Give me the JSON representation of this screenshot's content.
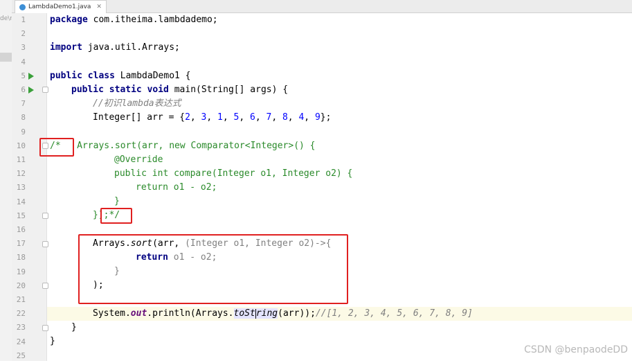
{
  "editor": {
    "tab_title": "LambdaDemo1.java",
    "left_panel_fragment": "de\\n",
    "watermark": "CSDN @benpaodeDD"
  },
  "lines": [
    {
      "n": "1"
    },
    {
      "n": "2"
    },
    {
      "n": "3"
    },
    {
      "n": "4"
    },
    {
      "n": "5"
    },
    {
      "n": "6"
    },
    {
      "n": "7"
    },
    {
      "n": "8"
    },
    {
      "n": "9"
    },
    {
      "n": "10"
    },
    {
      "n": "11"
    },
    {
      "n": "12"
    },
    {
      "n": "13"
    },
    {
      "n": "14"
    },
    {
      "n": "15"
    },
    {
      "n": "16"
    },
    {
      "n": "17"
    },
    {
      "n": "18"
    },
    {
      "n": "19"
    },
    {
      "n": "20"
    },
    {
      "n": "21"
    },
    {
      "n": "22"
    },
    {
      "n": "23"
    },
    {
      "n": "24"
    },
    {
      "n": "25"
    }
  ],
  "code": {
    "l1_kw": "package",
    "l1_rest": " com.itheima.lambdademo;",
    "l3_kw": "import",
    "l3_rest": " java.util.Arrays;",
    "l5_kw": "public class",
    "l5_rest": " LambdaDemo1 {",
    "l6_kw": "public static void",
    "l6_rest": " main(String[] args) {",
    "l7_cm": "//初识lambda表达式",
    "l8_a": "Integer[] arr = {",
    "l8_nums": [
      "2",
      "3",
      "1",
      "5",
      "6",
      "7",
      "8",
      "4",
      "9"
    ],
    "l8_end": "};",
    "l10_open": "/*",
    "l10_rest": "   Arrays.sort(arr, new Comparator<Integer>() {",
    "l11": "@Override",
    "l12": "public int compare(Integer o1, Integer o2) {",
    "l13": "return o1 - o2;",
    "l14": "}",
    "l15_a": "});",
    "l15_b": "*/",
    "l17_a": "Arrays.",
    "l17_m": "sort",
    "l17_b": "(arr, ",
    "l17_hint": "(Integer o1, Integer o2)->{",
    "l18_kw": "return",
    "l18_rest": " o1 - o2;",
    "l19": "}",
    "l20": ");",
    "l22_a": "System.",
    "l22_out": "out",
    "l22_b": ".println(Arrays.",
    "l22_m1": "toSt",
    "l22_m2": "ring",
    "l22_c": "(",
    "l22_arg": "arr",
    "l22_d": "));",
    "l22_cm": "//[1, 2, 3, 4, 5, 6, 7, 8, 9]",
    "l23": "}",
    "l24": "}"
  }
}
